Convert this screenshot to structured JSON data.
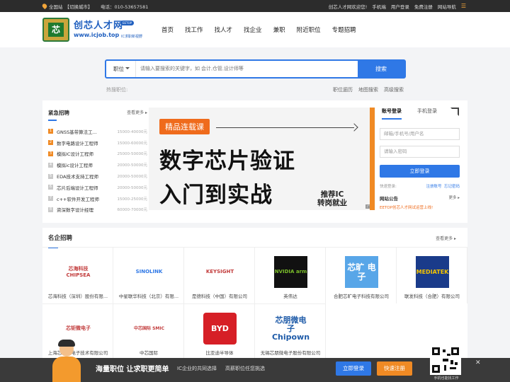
{
  "topbar": {
    "location": "全国站",
    "switch_city": "【切换城市】",
    "phone": "电话：010-53657581",
    "welcome": "创芯人才网欢迎您!",
    "mobile": "手机端",
    "login_reg": "用户登录",
    "free_reg": "免费注册",
    "site_nav": "网站导航"
  },
  "logo": {
    "name": "创芯人才网",
    "url": "www.icjob.top",
    "badge": "EETOP",
    "slogan": "IC求职新视野",
    "chip_char": "芯"
  },
  "nav": [
    "首页",
    "找工作",
    "找人才",
    "找企业",
    "兼职",
    "附近职位",
    "专题招聘"
  ],
  "search": {
    "category": "职位",
    "placeholder": "请输入要搜索的关键字，如 会计,仓管,设计师等",
    "button": "搜索",
    "hot_label": "热搜职位:",
    "links": [
      "职位逦历",
      "地图搜索",
      "高级搜索"
    ]
  },
  "urgent": {
    "title": "紧急招聘",
    "more": "查看更多",
    "items": [
      {
        "n": "1",
        "title": "GNSS基带算法工...",
        "salary": "15000-40000元"
      },
      {
        "n": "2",
        "title": "数字电路设计工程师",
        "salary": "15000-60000元"
      },
      {
        "n": "3",
        "title": "模拟IC设计工程师",
        "salary": "25000-50000元"
      },
      {
        "n": "4",
        "title": "模拟ic设计工程师",
        "salary": "20000-50000元"
      },
      {
        "n": "5",
        "title": "EDA技术支持工程师",
        "salary": "20000-50000元"
      },
      {
        "n": "6",
        "title": "芯片后端设计工程师",
        "salary": "20000-50000元"
      },
      {
        "n": "7",
        "title": "c++软件开发工程师",
        "salary": "15000-25000元"
      },
      {
        "n": "8",
        "title": "资深数字设计经理",
        "salary": "60000-70000元"
      }
    ]
  },
  "banner": {
    "tag": "精品连载课",
    "line1": "数字芯片验证",
    "line2": "入门到实战",
    "rec1": "推荐IC",
    "rec2": "转岗就业",
    "ad": "广告"
  },
  "login": {
    "tab_account": "账号登录",
    "tab_mobile": "手机登录",
    "username_placeholder": "邮箱/手机号/用户名",
    "password_placeholder": "请输入密码",
    "button": "立即登录",
    "fast": "快速登录:",
    "register": "注册账号",
    "forgot": "忘记密码",
    "notice_title": "网站公告",
    "notice_more": "更多",
    "notice_item": "EETOP创芯人才网试运营上线!"
  },
  "corp": {
    "title": "名企招聘",
    "more": "查看更多",
    "items": [
      {
        "name": "芯海科技（深圳）股份有限...",
        "logo": "芯海科技 CHIPSEA"
      },
      {
        "name": "中星联华科技（北京）有限...",
        "logo": "SINOLINK"
      },
      {
        "name": "是德科技（中国）有限公司",
        "logo": "KEYSIGHT"
      },
      {
        "name": "英伟达",
        "logo": "NVIDIA arm"
      },
      {
        "name": "合肥芯旷电子科技有限公司",
        "logo": "芯旷 电子"
      },
      {
        "name": "联发科技（合肥）有限公司",
        "logo": "MEDIATEK"
      },
      {
        "name": "上海芯钜微电子技术有限公司",
        "logo": "芯钜微电子"
      },
      {
        "name": "中芯国际",
        "logo": "中芯国际 SMIC"
      },
      {
        "name": "比亚迪半导体",
        "logo": "BYD"
      },
      {
        "name": "无锡芯朋微电子股份有限公司",
        "logo": "芯朋微电子 Chipown"
      }
    ]
  },
  "bottom": {
    "headline": "海量职位 让求职更简单",
    "sub1": "IC企业的共同选择",
    "sub2": "高薪职位任您挑选",
    "login": "立即登录",
    "register": "快速注册",
    "qr_text": "手机也能找工作",
    "close": "✕"
  },
  "colors": {
    "primary": "#2f78e6",
    "accent": "#f08a24",
    "dark_bar": "#2c2c2c"
  }
}
